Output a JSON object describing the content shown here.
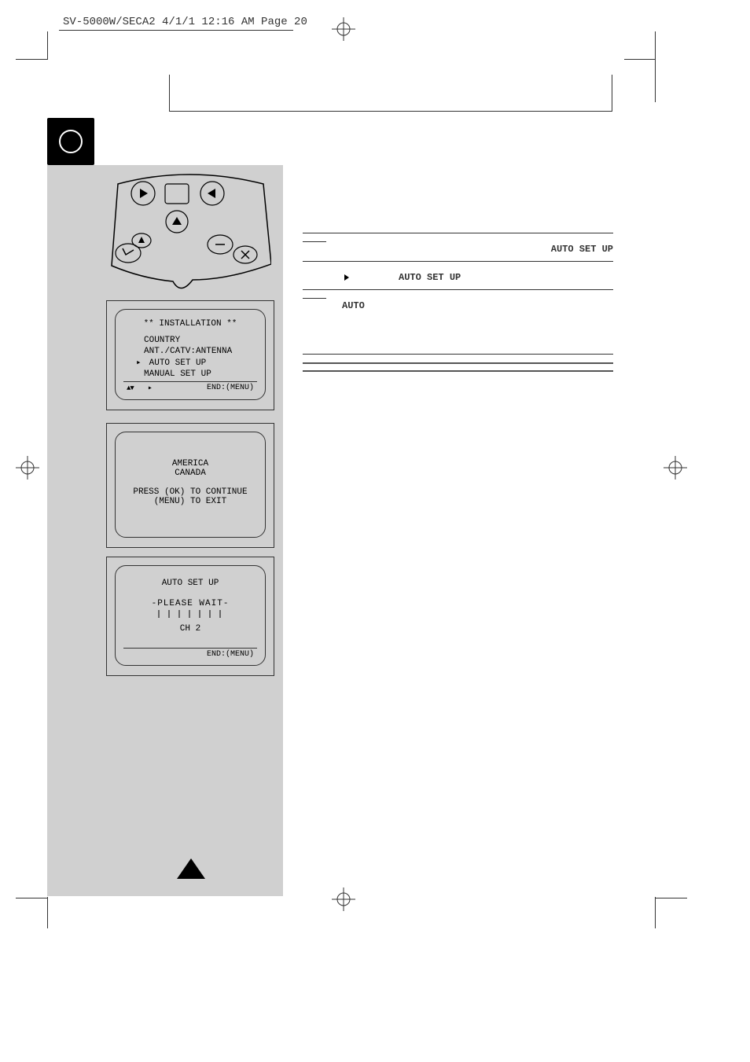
{
  "header": "SV-5000W/SECA2  4/1/1 12:16 AM  Page 20",
  "screen1": {
    "title": "** INSTALLATION **",
    "line1": "COUNTRY",
    "line2": "ANT./CATV:ANTENNA",
    "line3": "AUTO SET UP",
    "line4": "MANUAL SET UP",
    "footer_right": "END:(MENU)"
  },
  "screen2": {
    "line1": "AMERICA",
    "line2": "CANADA",
    "line3": "PRESS (OK) TO CONTINUE",
    "line4": "(MENU) TO EXIT"
  },
  "screen3": {
    "title": "AUTO SET UP",
    "wait": "PLEASE WAIT",
    "ch": "CH 2",
    "footer_right": "END:(MENU)"
  },
  "right": {
    "label1": "AUTO SET UP",
    "label2": "AUTO SET UP",
    "label3": "AUTO"
  }
}
